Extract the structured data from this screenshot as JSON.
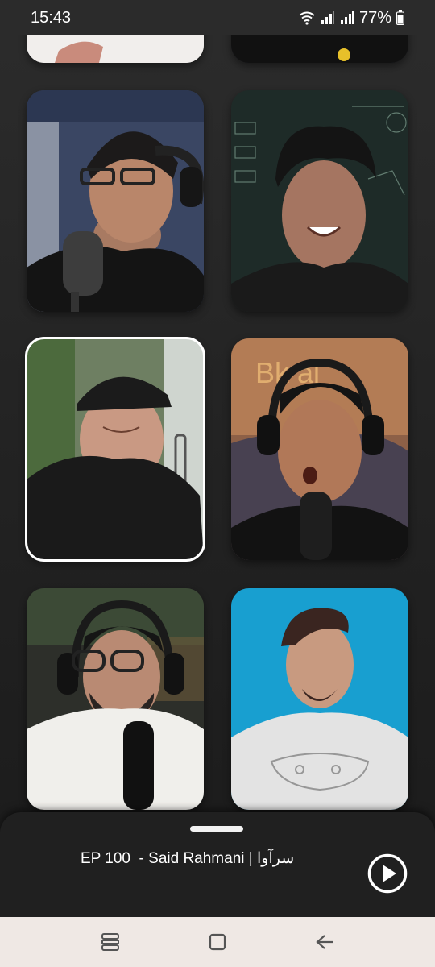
{
  "status_bar": {
    "time": "15:43",
    "battery": "77%",
    "icons": [
      "wifi-icon",
      "signal-icon",
      "signal-icon",
      "battery-icon"
    ]
  },
  "guests": [
    {
      "id": "guest-1",
      "description": "Man with glasses and headphones at microphone",
      "bg": "#3c4a66"
    },
    {
      "id": "guest-2",
      "description": "Smiling man in front of chalkboard",
      "bg": "#1f2a25"
    },
    {
      "id": "guest-3",
      "description": "Man in black cap by window",
      "bg": "#5a6e55"
    },
    {
      "id": "guest-4",
      "description": "Man with headphones surprised at microphone",
      "bg": "#8a5a3a"
    },
    {
      "id": "guest-5",
      "description": "Bearded man with glasses and headphones",
      "bg": "#3b3a35"
    },
    {
      "id": "guest-6",
      "description": "Man in grey t-shirt on blue background",
      "bg": "#1a9cc6"
    }
  ],
  "player": {
    "episode_title": "EP 100  - Said Rahmani | سرآوا",
    "play_icon": "play-circle-icon"
  },
  "navbar": {
    "icons": [
      "recent-apps-icon",
      "home-icon",
      "back-icon"
    ]
  },
  "colors": {
    "background": "#1e1e1e",
    "player_bg": "#202020",
    "navbar_bg": "#efe8e4",
    "accent": "#ffffff"
  }
}
